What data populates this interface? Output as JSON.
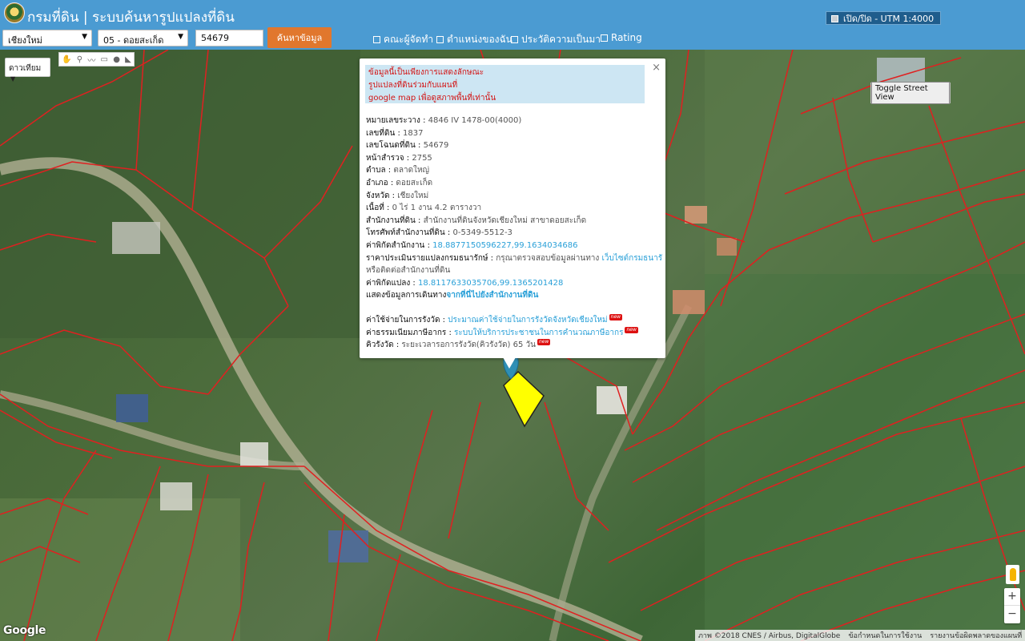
{
  "header": {
    "title": "กรมที่ดิน | ระบบค้นหารูปแปลงที่ดิน",
    "utm_toggle_label": "เปิด/ปิด - UTM 1:4000",
    "province_select": "เชียงใหม่",
    "district_select": "05 - ดอยสะเก็ด",
    "deed_number_value": "54679",
    "search_button_label": "ค้นหาข้อมูล",
    "nav": [
      {
        "label": "คณะผู้จัดทำ"
      },
      {
        "label": "ตำแหน่งของฉัน"
      },
      {
        "label": "ประวัติความเป็นมา"
      },
      {
        "label": "Rating"
      }
    ]
  },
  "map": {
    "map_type_label": "ดาวเทียม",
    "streetview_label": "Toggle Street View",
    "google_logo": "Google",
    "attribution": {
      "imagery": "ภาพ ©2018 CNES / Airbus, DigitalGlobe",
      "terms": "ข้อกำหนดในการใช้งาน",
      "report": "รายงานข้อผิดพลาดของแผนที่"
    },
    "colors": {
      "parcel_lines": "#e02020",
      "selected_parcel": "#ffff00",
      "marker": "#2f8fb5"
    }
  },
  "popup": {
    "notice_lines": [
      "ข้อมูลนี้เป็นเพียงการแสดงลักษณะ",
      "รูปแปลงที่ดินร่วมกับแผนที่",
      "google map เพื่อดูสภาพพื้นที่เท่านั้น"
    ],
    "rows": {
      "map_sheet_label": "หมายเลขระวาง :",
      "map_sheet_value": "4846 IV 1478-00(4000)",
      "land_no_label": "เลขที่ดิน :",
      "land_no_value": "1837",
      "deed_no_label": "เลขโฉนดที่ดิน :",
      "deed_no_value": "54679",
      "survey_page_label": "หน้าสำรวจ :",
      "survey_page_value": "2755",
      "subdistrict_label": "ตำบล :",
      "subdistrict_value": "ตลาดใหญ่",
      "district_label": "อำเภอ :",
      "district_value": "ดอยสะเก็ด",
      "province_label": "จังหวัด :",
      "province_value": "เชียงใหม่",
      "area_label": "เนื้อที่ :",
      "area_value": "0 ไร่ 1 งาน 4.2 ตารางวา",
      "office_label": "สำนักงานที่ดิน :",
      "office_value": "สำนักงานที่ดินจังหวัดเชียงใหม่ สาขาดอยสะเก็ด",
      "phone_label": "โทรศัพท์สำนักงานที่ดิน :",
      "phone_value": "0-5349-5512-3",
      "office_coord_label": "ค่าพิกัดสำนักงาน :",
      "office_coord_value": "18.8877150596227,99.1634034686",
      "price_label": "ราคาประเมินรายแปลงกรมธนารักษ์ :",
      "price_text": "กรุณาตรวจสอบข้อมูลผ่านทาง",
      "price_link": "เว็บไซต์กรมธนารักษ์",
      "price_text2": "หรือติดต่อสำนักงานที่ดิน",
      "parcel_coord_label": "ค่าพิกัดแปลง :",
      "parcel_coord_value": "18.8117633035706,99.1365201428",
      "directions_label": "แสดงข้อมูลการเดินทาง",
      "directions_link": "จากที่นี่ไปยังสำนักงานที่ดิน",
      "fee_label": "ค่าใช้จ่ายในการรังวัด :",
      "fee_link": "ประมาณค่าใช้จ่ายในการรังวัดจังหวัดเชียงใหม่",
      "tax_label": "ค่าธรรมเนียมภาษีอากร :",
      "tax_link": "ระบบให้บริการประชาชนในการคำนวณภาษีอากร",
      "queue_label": "คิวรังวัด :",
      "queue_value": "ระยะเวลารอการรังวัด(คิวรังวัด) 65 วัน",
      "new_badge": "new"
    }
  }
}
